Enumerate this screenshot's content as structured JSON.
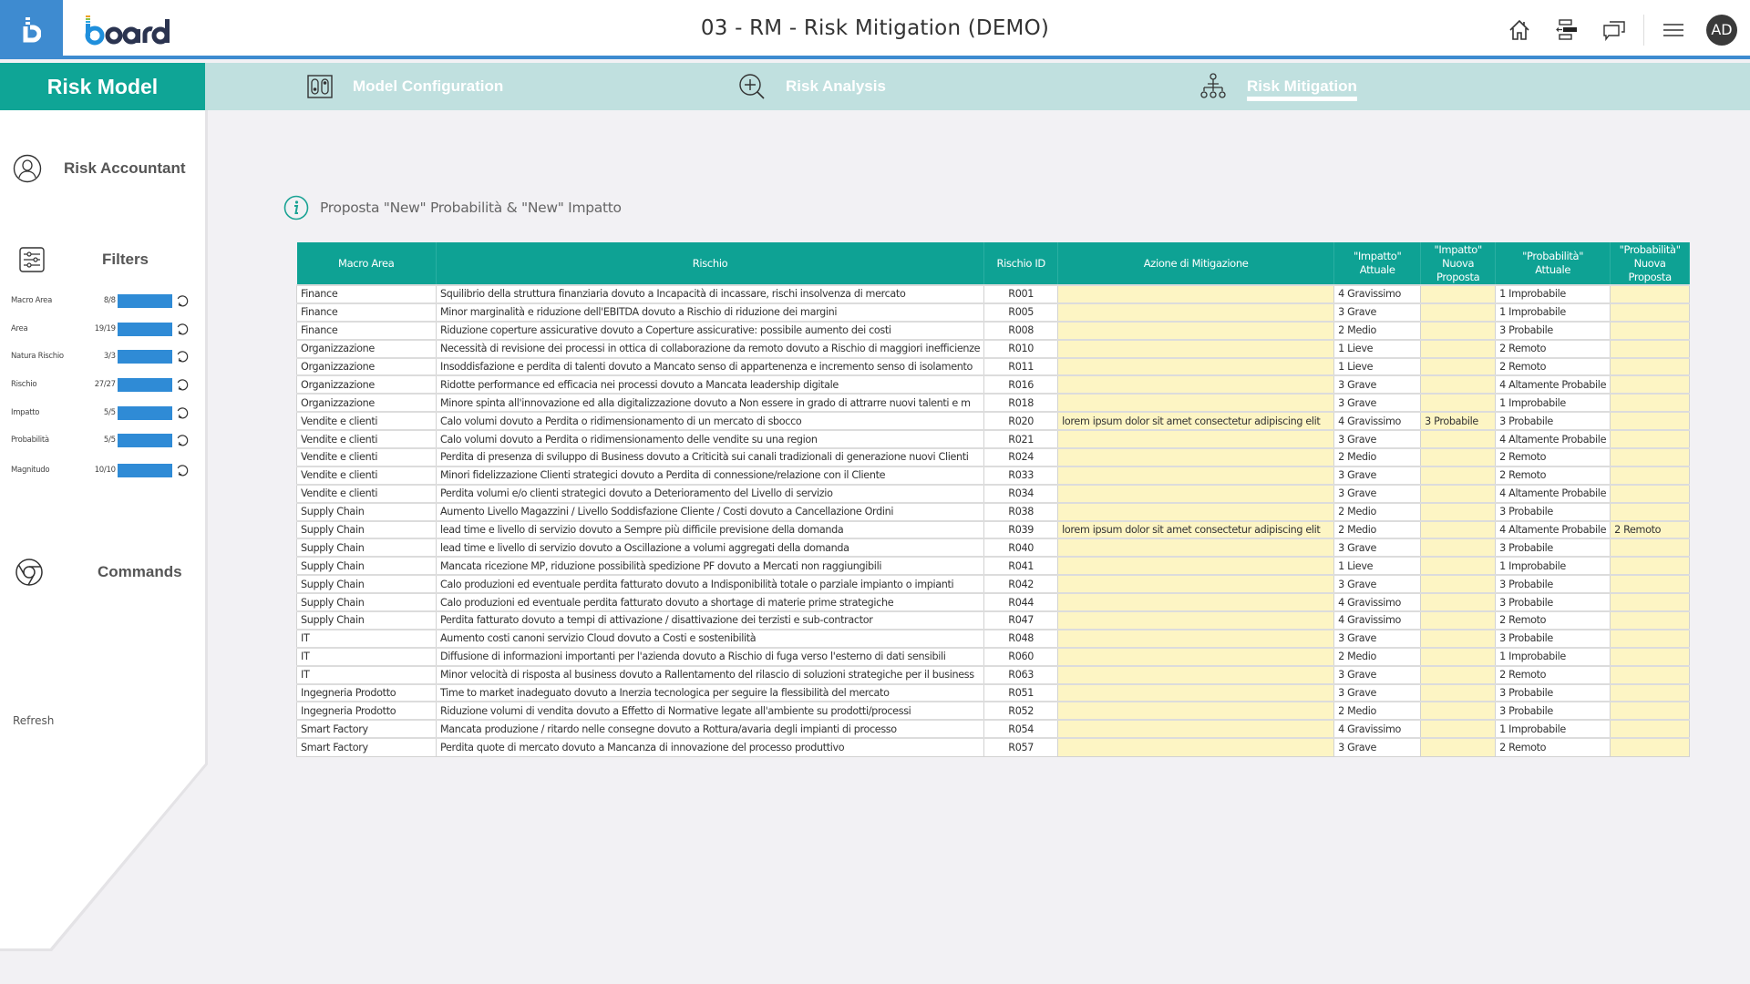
{
  "header": {
    "app_title": "03 - RM - Risk Mitigation (DEMO)",
    "brand": "board",
    "icons": [
      "home-icon",
      "panel-collapse-icon",
      "chat-icon",
      "menu-icon"
    ],
    "avatar_initials": "AD"
  },
  "nav": {
    "home_label": "Risk Model",
    "items": [
      {
        "label": "Model Configuration",
        "icon": "model-config-icon",
        "active": false
      },
      {
        "label": "Risk Analysis",
        "icon": "zoom-in-icon",
        "active": false
      },
      {
        "label": "Risk Mitigation",
        "icon": "hierarchy-icon",
        "active": true
      }
    ]
  },
  "sidebar": {
    "user_section": "Risk Accountant",
    "filters_title": "Filters",
    "filters": [
      {
        "label": "Macro Area",
        "count": "8/8",
        "fill": 1.0
      },
      {
        "label": "Area",
        "count": "19/19",
        "fill": 1.0
      },
      {
        "label": "Natura Rischio",
        "count": "3/3",
        "fill": 1.0
      },
      {
        "label": "Rischio",
        "count": "27/27",
        "fill": 1.0
      },
      {
        "label": "Impatto",
        "count": "5/5",
        "fill": 1.0
      },
      {
        "label": "Probabilità",
        "count": "5/5",
        "fill": 1.0
      },
      {
        "label": "Magnitudo",
        "count": "10/10",
        "fill": 1.0
      }
    ],
    "commands_title": "Commands",
    "refresh_label": "Refresh"
  },
  "main": {
    "info_text": "Proposta \"New\" Probabilità  & \"New\" Impatto",
    "colors": {
      "header": "#0ea294",
      "editable": "#fdf5c4",
      "accent": "#3e8bd0"
    },
    "columns": [
      "Macro Area",
      "Rischio",
      "Rischio ID",
      "Azione di Mitigazione",
      "\"Impatto\" Attuale",
      "\"Impatto\" Nuova Proposta",
      "\"Probabilità\" Attuale",
      "\"Probabilità\" Nuova Proposta"
    ],
    "rows": [
      [
        "Finance",
        "Squilibrio della struttura finanziaria dovuto a Incapacità di incassare, rischi insolvenza di mercato",
        "R001",
        "",
        "4 Gravissimo",
        "",
        "1 Improbabile",
        ""
      ],
      [
        "Finance",
        "Minor marginalità e riduzione dell'EBITDA dovuto a Rischio di riduzione dei margini",
        "R005",
        "",
        "3 Grave",
        "",
        "1 Improbabile",
        ""
      ],
      [
        "Finance",
        "Riduzione coperture assicurative  dovuto a Coperture assicurative: possibile aumento dei costi",
        "R008",
        "",
        "2 Medio",
        "",
        "3 Probabile",
        ""
      ],
      [
        "Organizzazione",
        "Necessità di revisione dei processi in ottica di collaborazione da remoto dovuto a Rischio di maggiori inefficienze",
        "R010",
        "",
        "1 Lieve",
        "",
        "2 Remoto",
        ""
      ],
      [
        "Organizzazione",
        "Insoddisfazione e perdita di talenti dovuto a Mancato senso di appartenenza e incremento senso di isolamento",
        "R011",
        "",
        "1 Lieve",
        "",
        "2 Remoto",
        ""
      ],
      [
        "Organizzazione",
        "Ridotte performance ed efficacia nei processi dovuto a Mancata leadership digitale",
        "R016",
        "",
        "3 Grave",
        "",
        "4 Altamente Probabile",
        ""
      ],
      [
        "Organizzazione",
        "Minore spinta all'innovazione ed alla digitalizzazione dovuto a Non essere in grado di attrarre nuovi talenti e m",
        "R018",
        "",
        "3 Grave",
        "",
        "1 Improbabile",
        ""
      ],
      [
        "Vendite e clienti",
        "Calo volumi  dovuto a Perdita o ridimensionamento di un mercato di sbocco",
        "R020",
        "lorem ipsum dolor sit amet consectetur adipiscing elit",
        "4 Gravissimo",
        "3 Probabile",
        "3 Probabile",
        ""
      ],
      [
        "Vendite e clienti",
        "Calo volumi  dovuto a Perdita o ridimensionamento delle vendite su una region",
        "R021",
        "",
        "3 Grave",
        "",
        "4 Altamente Probabile",
        ""
      ],
      [
        "Vendite e clienti",
        "Perdita di presenza di sviluppo di Business dovuto a Criticità sui canali tradizionali di generazione nuovi Clienti",
        "R024",
        "",
        "2 Medio",
        "",
        "2 Remoto",
        ""
      ],
      [
        "Vendite e clienti",
        "Minori fidelizzazione Clienti strategici dovuto a Perdita di connessione/relazione con il Cliente",
        "R033",
        "",
        "3 Grave",
        "",
        "2 Remoto",
        ""
      ],
      [
        "Vendite e clienti",
        "Perdita volumi e/o clienti strategici dovuto a Deterioramento del Livello di servizio",
        "R034",
        "",
        "3 Grave",
        "",
        "4 Altamente Probabile",
        ""
      ],
      [
        "Supply Chain",
        "Aumento Livello Magazzini / Livello Soddisfazione Cliente / Costi dovuto a Cancellazione Ordini",
        "R038",
        "",
        "2 Medio",
        "",
        "3 Probabile",
        ""
      ],
      [
        "Supply Chain",
        "lead time e livello di servizio dovuto a Sempre più difficile previsione della domanda",
        "R039",
        "lorem ipsum dolor sit amet consectetur adipiscing elit",
        "2 Medio",
        "",
        "4 Altamente Probabile",
        "2 Remoto"
      ],
      [
        "Supply Chain",
        "lead time e livello di servizio dovuto a Oscillazione a volumi aggregati della domanda",
        "R040",
        "",
        "3 Grave",
        "",
        "3 Probabile",
        ""
      ],
      [
        "Supply Chain",
        "Mancata ricezione MP, riduzione possibilità spedizione PF dovuto a Mercati non raggiungibili",
        "R041",
        "",
        "1 Lieve",
        "",
        "1 Improbabile",
        ""
      ],
      [
        "Supply Chain",
        "Calo produzioni ed eventuale perdita fatturato dovuto a Indisponibilità totale o parziale impianto o impianti",
        "R042",
        "",
        "3 Grave",
        "",
        "3 Probabile",
        ""
      ],
      [
        "Supply Chain",
        "Calo produzioni ed eventuale perdita fatturato dovuto a shortage di materie prime strategiche",
        "R044",
        "",
        "4 Gravissimo",
        "",
        "3 Probabile",
        ""
      ],
      [
        "Supply Chain",
        "Perdita fatturato dovuto a tempi di attivazione / disattivazione dei terzisti e sub-contractor",
        "R047",
        "",
        "4 Gravissimo",
        "",
        "2 Remoto",
        ""
      ],
      [
        "IT",
        "Aumento costi canoni servizio Cloud dovuto a Costi e sostenibilità",
        "R048",
        "",
        "3 Grave",
        "",
        "3 Probabile",
        ""
      ],
      [
        "IT",
        "Diffusione di informazioni importanti per l'azienda dovuto a Rischio di fuga verso l'esterno di dati sensibili",
        "R060",
        "",
        "2 Medio",
        "",
        "1 Improbabile",
        ""
      ],
      [
        "IT",
        "Minor velocità di risposta al business dovuto a Rallentamento del rilascio di soluzioni strategiche per il business",
        "R063",
        "",
        "3 Grave",
        "",
        "2 Remoto",
        ""
      ],
      [
        "Ingegneria Prodotto",
        "Time to market inadeguato  dovuto a Inerzia tecnologica per seguire la flessibilità del mercato",
        "R051",
        "",
        "3 Grave",
        "",
        "3 Probabile",
        ""
      ],
      [
        "Ingegneria Prodotto",
        "Riduzione volumi di vendita dovuto a Effetto di Normative legate all'ambiente su prodotti/processi",
        "R052",
        "",
        "2 Medio",
        "",
        "3 Probabile",
        ""
      ],
      [
        "Smart Factory",
        "Mancata produzione / ritardo nelle consegne dovuto a Rottura/avaria degli impianti di processo",
        "R054",
        "",
        "4 Gravissimo",
        "",
        "1 Improbabile",
        ""
      ],
      [
        "Smart Factory",
        "Perdita quote di mercato dovuto a Mancanza di innovazione del processo produttivo",
        "R057",
        "",
        "3 Grave",
        "",
        "2 Remoto",
        ""
      ]
    ]
  }
}
